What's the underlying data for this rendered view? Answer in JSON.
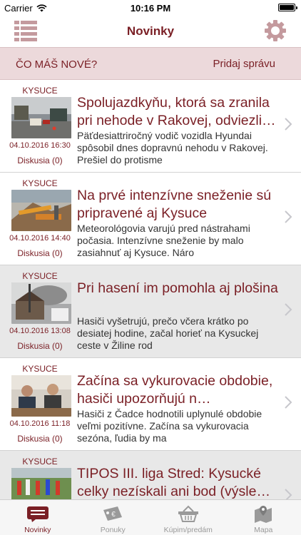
{
  "status_bar": {
    "carrier": "Carrier",
    "time": "10:16 PM"
  },
  "nav": {
    "title": "Novinky"
  },
  "compose": {
    "prompt": "ČO MÁŠ NOVÉ?",
    "button": "Pridaj správu"
  },
  "articles": [
    {
      "region": "KYSUCE",
      "title": "Spolujazdkyňu, ktorá sa zranila pri nehode v Rakovej, odviezli…",
      "snippet": "Päťdesiattriročný vodič vozidla Hyundai spôsobil dnes dopravnú nehodu v Rakovej. Prešiel do protisme",
      "date": "04.10.2016 16:30",
      "discussion": "Diskusia (0)"
    },
    {
      "region": "KYSUCE",
      "title": "Na prvé intenzívne sneženie sú pripravené aj Kysuce",
      "snippet": "Meteorológovia varujú pred nástrahami počasia. Intenzívne sneženie by malo zasiahnuť aj Kysuce. Náro",
      "date": "04.10.2016 14:40",
      "discussion": "Diskusia (0)"
    },
    {
      "region": "KYSUCE",
      "title": "Pri hasení im pomohla aj plošina",
      "snippet": "Hasiči vyšetrujú, prečo včera krátko po desiatej hodine, začal horieť na Kysuckej ceste v Žiline rod",
      "date": "04.10.2016 13:08",
      "discussion": "Diskusia (0)"
    },
    {
      "region": "KYSUCE",
      "title": "Začína sa vykurovacie obdobie, hasiči upozorňujú n…",
      "snippet": "Hasiči z Čadce hodnotili uplynulé obdobie veľmi pozitívne. Začína sa vykurovacia sezóna, ľudia by ma",
      "date": "04.10.2016 11:18",
      "discussion": "Diskusia (0)"
    },
    {
      "region": "KYSUCE",
      "title": "TIPOS III. liga Stred: Kysucké celky nezískali ani bod (výsle…",
      "snippet": "",
      "date": "",
      "discussion": ""
    }
  ],
  "tabs": [
    {
      "label": "Novinky",
      "icon": "news-icon",
      "active": true
    },
    {
      "label": "Ponuky",
      "icon": "offers-icon",
      "active": false
    },
    {
      "label": "Kúpim/predám",
      "icon": "basket-icon",
      "active": false
    },
    {
      "label": "Mapa",
      "icon": "map-icon",
      "active": false
    }
  ],
  "colors": {
    "accent": "#7a1f25",
    "compose_bg": "#ecd9db",
    "row_shade": "#e8e8e8",
    "tab_inactive": "#9a9a9a"
  }
}
